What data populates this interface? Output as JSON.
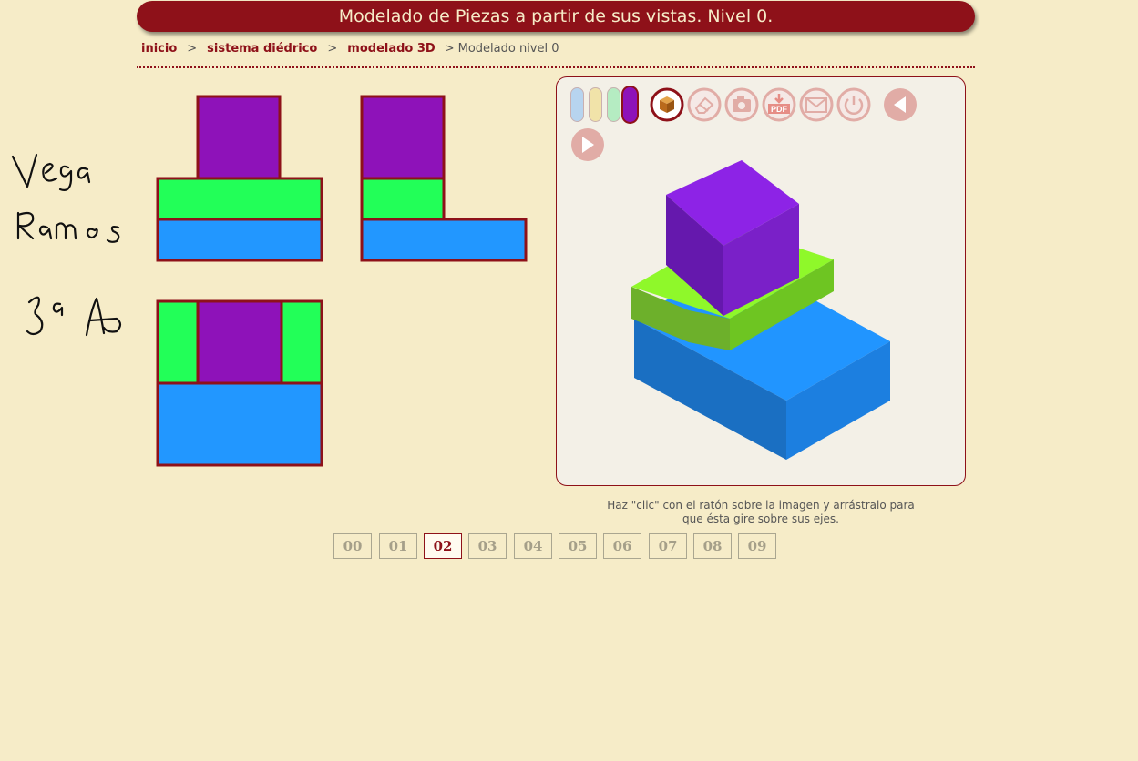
{
  "header": {
    "title": "Modelado de Piezas a partir de sus vistas. Nivel 0."
  },
  "breadcrumb": {
    "items": [
      "inicio",
      "sistema diédrico",
      "modelado 3D"
    ],
    "separator": ">",
    "current": "Modelado nivel 0"
  },
  "views": {
    "colors": {
      "purple": "#8e12b9",
      "green": "#22ff58",
      "blue": "#2297ff",
      "outline": "#8e1119"
    }
  },
  "handwriting": {
    "lines": [
      "Vega",
      "Ramos",
      "3ºA"
    ]
  },
  "viewer": {
    "toolbar": {
      "color_swatches": [
        "#b7d4ef",
        "#f1e3a9",
        "#b5ecc2",
        "#8e12b9"
      ],
      "buttons": [
        {
          "name": "cube-view-icon",
          "active": true
        },
        {
          "name": "eraser-icon",
          "active": false
        },
        {
          "name": "camera-icon",
          "active": false
        },
        {
          "name": "pdf-download-icon",
          "label": "PDF",
          "active": false
        },
        {
          "name": "email-icon",
          "active": false
        },
        {
          "name": "power-icon",
          "active": false
        },
        {
          "name": "previous-icon",
          "active": false
        },
        {
          "name": "next-icon",
          "active": false
        }
      ]
    },
    "model_colors": {
      "purple": "#8d23e6",
      "green": "#8ff82a",
      "blue": "#2195ff"
    }
  },
  "caption": {
    "line1": "Haz \"clic\" con el ratón sobre la imagen y arrástralo para",
    "line2": "que ésta gire sobre sus ejes."
  },
  "pager": {
    "pages": [
      "00",
      "01",
      "02",
      "03",
      "04",
      "05",
      "06",
      "07",
      "08",
      "09"
    ],
    "active": "02"
  }
}
